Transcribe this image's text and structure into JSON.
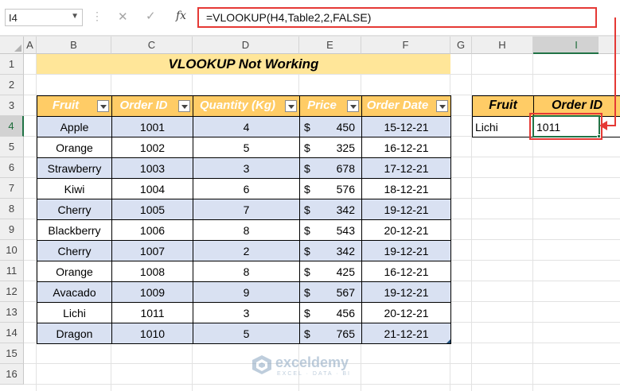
{
  "formula_bar": {
    "name_box": "I4",
    "cancel_icon": "✕",
    "enter_icon": "✓",
    "fx_label": "fx",
    "formula": "=VLOOKUP(H4,Table2,2,FALSE)"
  },
  "columns": [
    "A",
    "B",
    "C",
    "D",
    "E",
    "F",
    "G",
    "H",
    "I"
  ],
  "rows": [
    "1",
    "2",
    "3",
    "4",
    "5",
    "6",
    "7",
    "8",
    "9",
    "10",
    "11",
    "12",
    "13",
    "14",
    "15",
    "16"
  ],
  "active_cell": {
    "column": "I",
    "row": "4"
  },
  "title": "VLOOKUP Not Working",
  "table": {
    "headers": [
      "Fruit",
      "Order ID",
      "Quantity (Kg)",
      "Price",
      "Order Date"
    ],
    "rows": [
      {
        "fruit": "Apple",
        "order_id": "1001",
        "quantity": "4",
        "currency": "$",
        "price": "450",
        "date": "15-12-21"
      },
      {
        "fruit": "Orange",
        "order_id": "1002",
        "quantity": "5",
        "currency": "$",
        "price": "325",
        "date": "16-12-21"
      },
      {
        "fruit": "Strawberry",
        "order_id": "1003",
        "quantity": "3",
        "currency": "$",
        "price": "678",
        "date": "17-12-21"
      },
      {
        "fruit": "Kiwi",
        "order_id": "1004",
        "quantity": "6",
        "currency": "$",
        "price": "576",
        "date": "18-12-21"
      },
      {
        "fruit": "Cherry",
        "order_id": "1005",
        "quantity": "7",
        "currency": "$",
        "price": "342",
        "date": "19-12-21"
      },
      {
        "fruit": "Blackberry",
        "order_id": "1006",
        "quantity": "8",
        "currency": "$",
        "price": "543",
        "date": "20-12-21"
      },
      {
        "fruit": "Cherry",
        "order_id": "1007",
        "quantity": "2",
        "currency": "$",
        "price": "342",
        "date": "19-12-21"
      },
      {
        "fruit": "Orange",
        "order_id": "1008",
        "quantity": "8",
        "currency": "$",
        "price": "425",
        "date": "16-12-21"
      },
      {
        "fruit": "Avacado",
        "order_id": "1009",
        "quantity": "9",
        "currency": "$",
        "price": "567",
        "date": "19-12-21"
      },
      {
        "fruit": "Lichi",
        "order_id": "1011",
        "quantity": "3",
        "currency": "$",
        "price": "456",
        "date": "20-12-21"
      },
      {
        "fruit": "Dragon",
        "order_id": "1010",
        "quantity": "5",
        "currency": "$",
        "price": "765",
        "date": "21-12-21"
      }
    ]
  },
  "lookup": {
    "headers": [
      "Fruit",
      "Order ID"
    ],
    "fruit": "Lichi",
    "order_id": "1011"
  },
  "watermark": {
    "name": "exceldemy",
    "tagline": "EXCEL · DATA · BI"
  },
  "colors": {
    "title_fill": "#ffe699",
    "header_fill": "#ffcc66",
    "band_fill": "#d9e1f2",
    "highlight_red": "#e53935",
    "excel_green": "#217346"
  }
}
